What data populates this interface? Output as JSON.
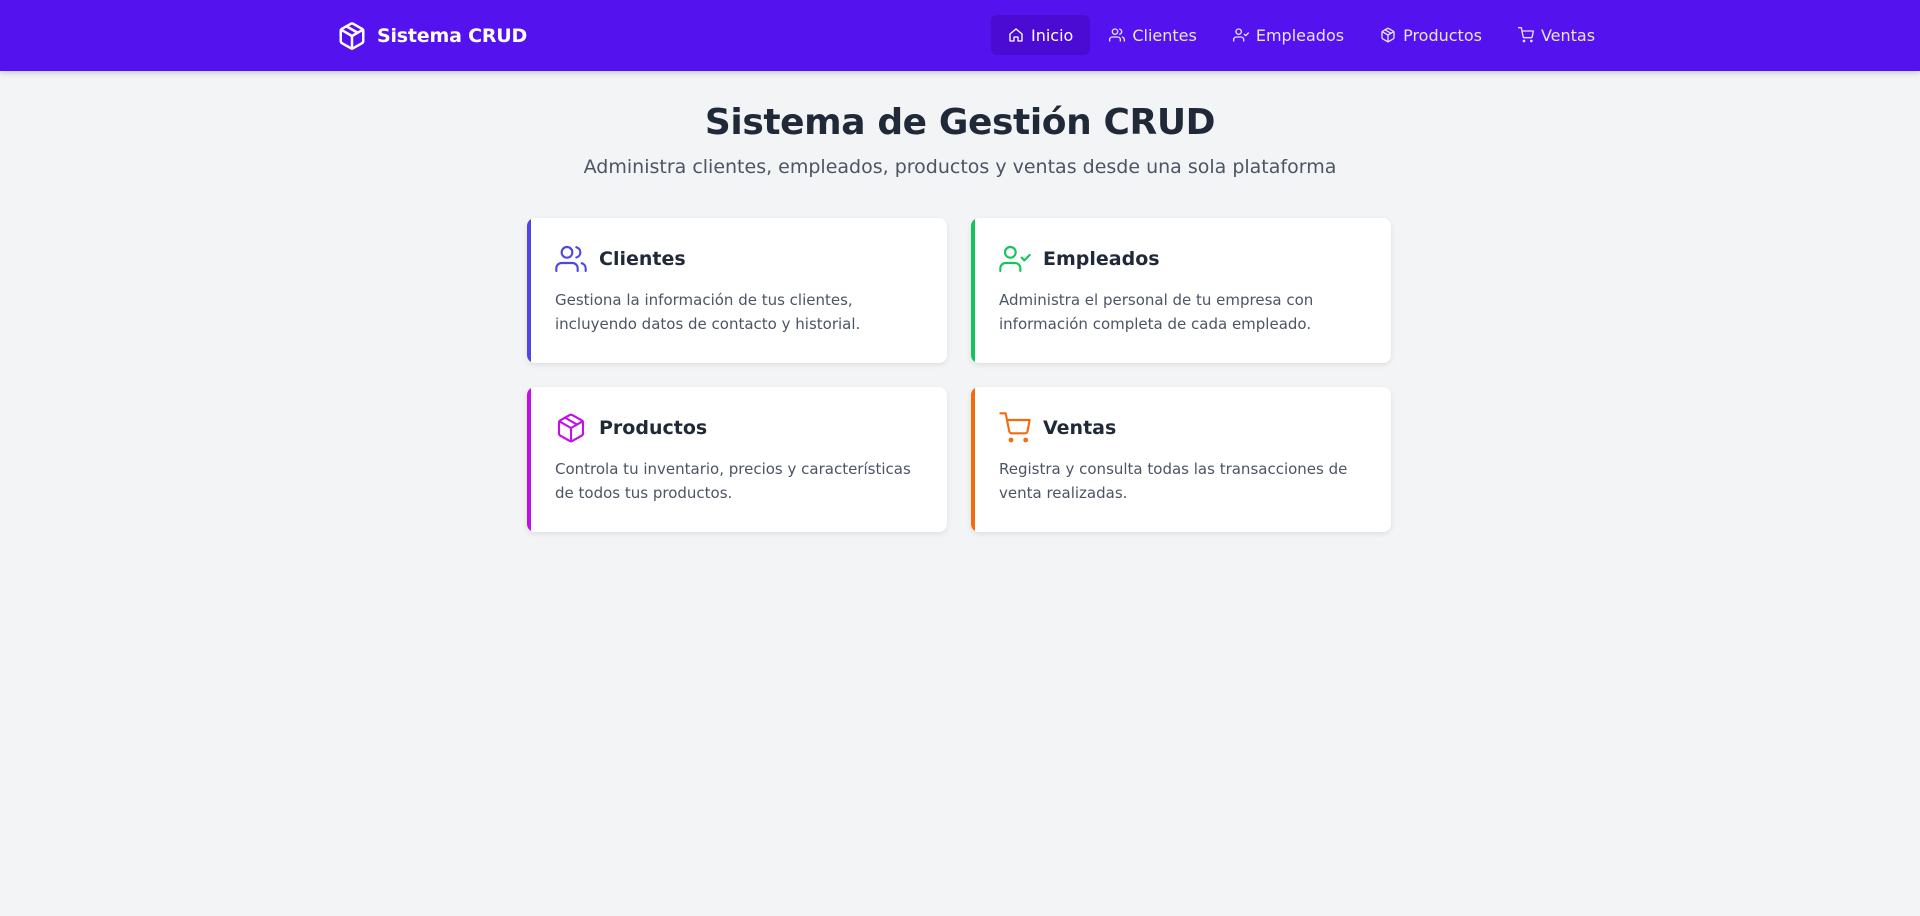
{
  "brand": {
    "name": "Sistema CRUD",
    "icon": "package-icon"
  },
  "nav": {
    "items": [
      {
        "label": "Inicio",
        "icon": "home-icon",
        "active": true
      },
      {
        "label": "Clientes",
        "icon": "users-icon",
        "active": false
      },
      {
        "label": "Empleados",
        "icon": "user-check-icon",
        "active": false
      },
      {
        "label": "Productos",
        "icon": "package-icon",
        "active": false
      },
      {
        "label": "Ventas",
        "icon": "shopping-cart-icon",
        "active": false
      }
    ]
  },
  "header": {
    "title": "Sistema de Gestión CRUD",
    "subtitle": "Administra clientes, empleados, productos y ventas desde una sola plataforma"
  },
  "cards": [
    {
      "title": "Clientes",
      "icon": "users-icon",
      "color": "#4f46e5",
      "description": "Gestiona la información de tus clientes, incluyendo datos de contacto y historial."
    },
    {
      "title": "Empleados",
      "icon": "user-check-icon",
      "color": "#16c35a",
      "description": "Administra el personal de tu empresa con información completa de cada empleado."
    },
    {
      "title": "Productos",
      "icon": "package-icon",
      "color": "#c011e6",
      "description": "Controla tu inventario, precios y características de todos tus productos."
    },
    {
      "title": "Ventas",
      "icon": "shopping-cart-icon",
      "color": "#f26b0f",
      "description": "Registra y consulta todas las transacciones de venta realizadas."
    }
  ],
  "colors": {
    "navbar": "#5412ef",
    "nav_active": "#4b0bd3",
    "background": "#f3f4f6"
  }
}
